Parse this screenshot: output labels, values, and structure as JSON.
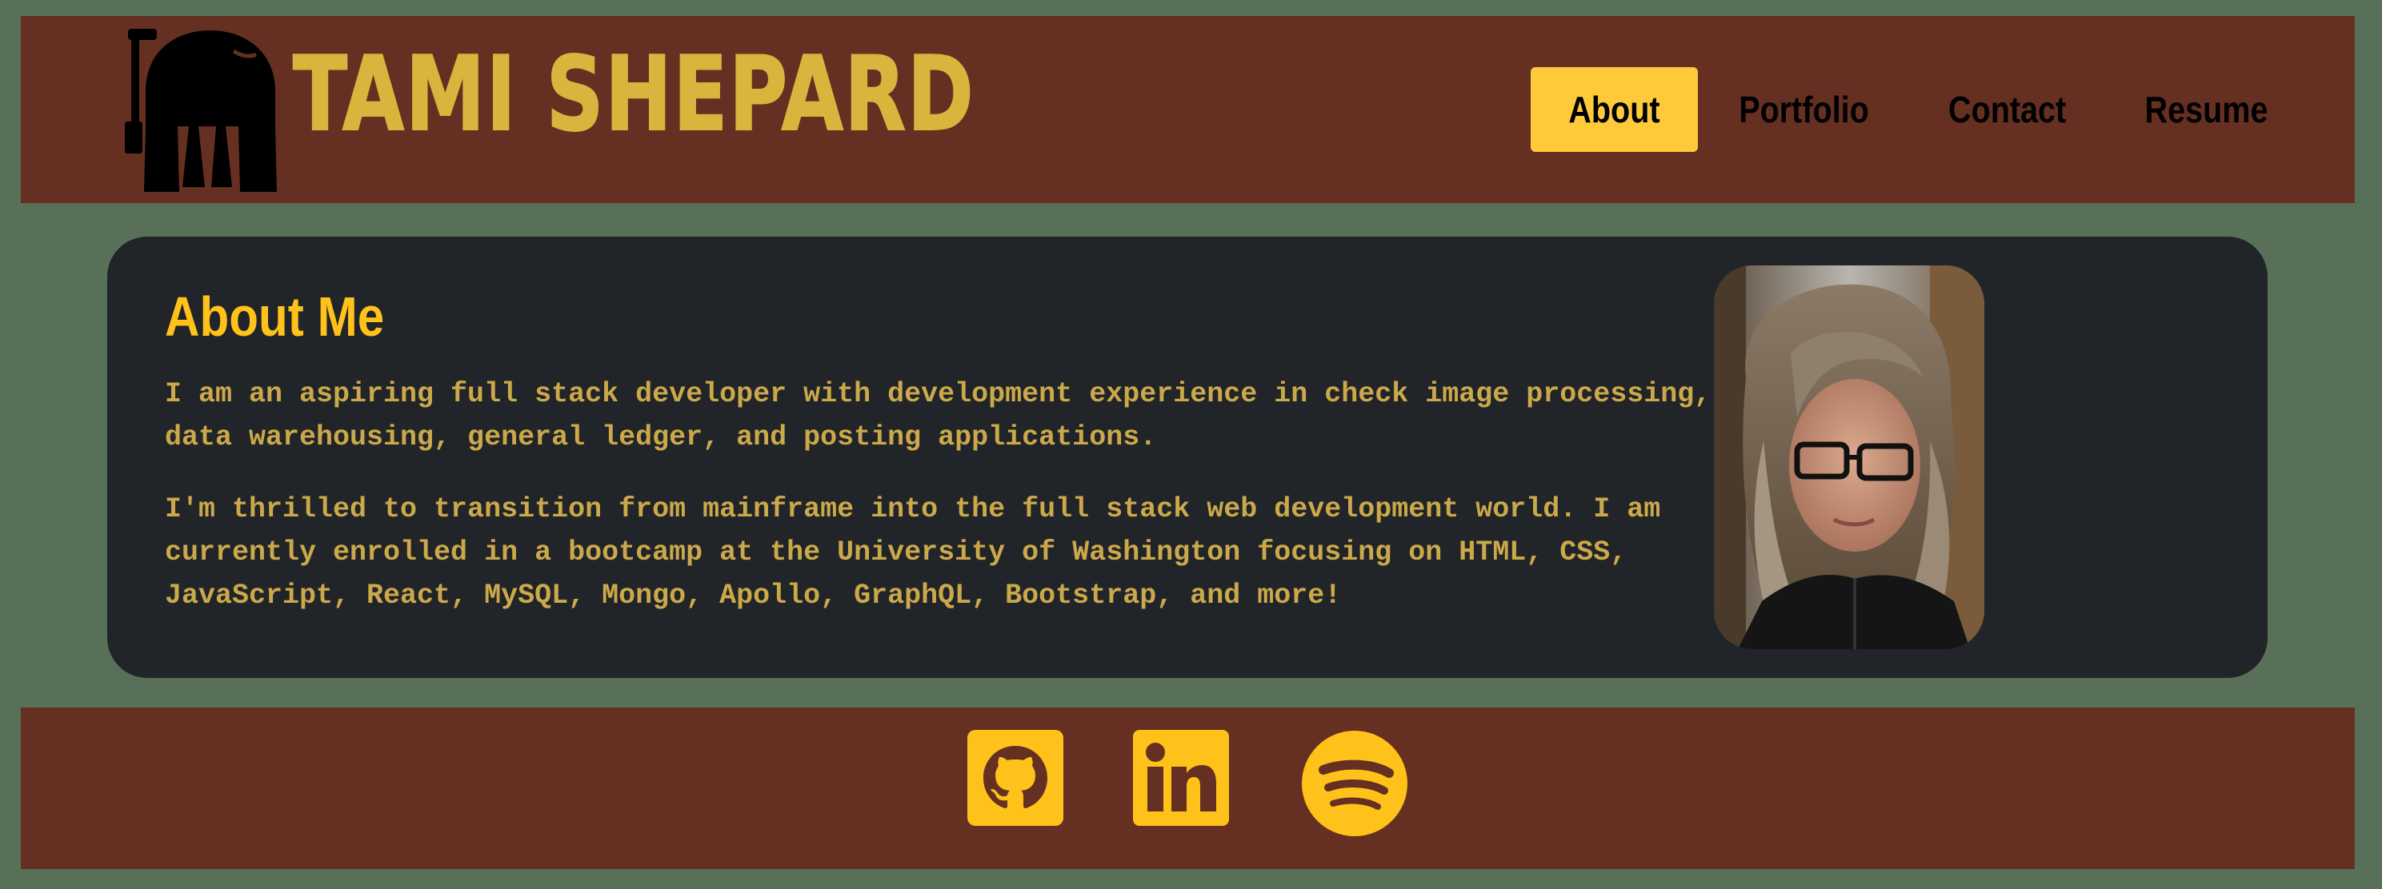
{
  "colors": {
    "background": "#587058",
    "header_bg": "#653021",
    "card_bg": "#212428",
    "accent": "#ffc21a",
    "nav_active": "#ffca3a",
    "title_gold": "#d8b53c",
    "body_text": "#cba94a"
  },
  "header": {
    "logo_icon": "mandalorian-helmet-icon",
    "title": "TAMI SHEPARD",
    "nav": [
      {
        "label": "About",
        "active": true
      },
      {
        "label": "Portfolio",
        "active": false
      },
      {
        "label": "Contact",
        "active": false
      },
      {
        "label": "Resume",
        "active": false
      }
    ]
  },
  "about": {
    "heading": "About Me",
    "paragraphs": [
      "I am an aspiring full stack developer with development experience in check image processing, data warehousing, general ledger, and posting applications.",
      "I'm thrilled to transition from mainframe into the full stack web development world. I am currently enrolled in a bootcamp at the University of Washington focusing on HTML, CSS, JavaScript, React, MySQL, Mongo, Apollo, GraphQL, Bootstrap, and more!"
    ]
  },
  "footer": {
    "social_icons": [
      "github-icon",
      "linkedin-icon",
      "spotify-icon"
    ]
  }
}
